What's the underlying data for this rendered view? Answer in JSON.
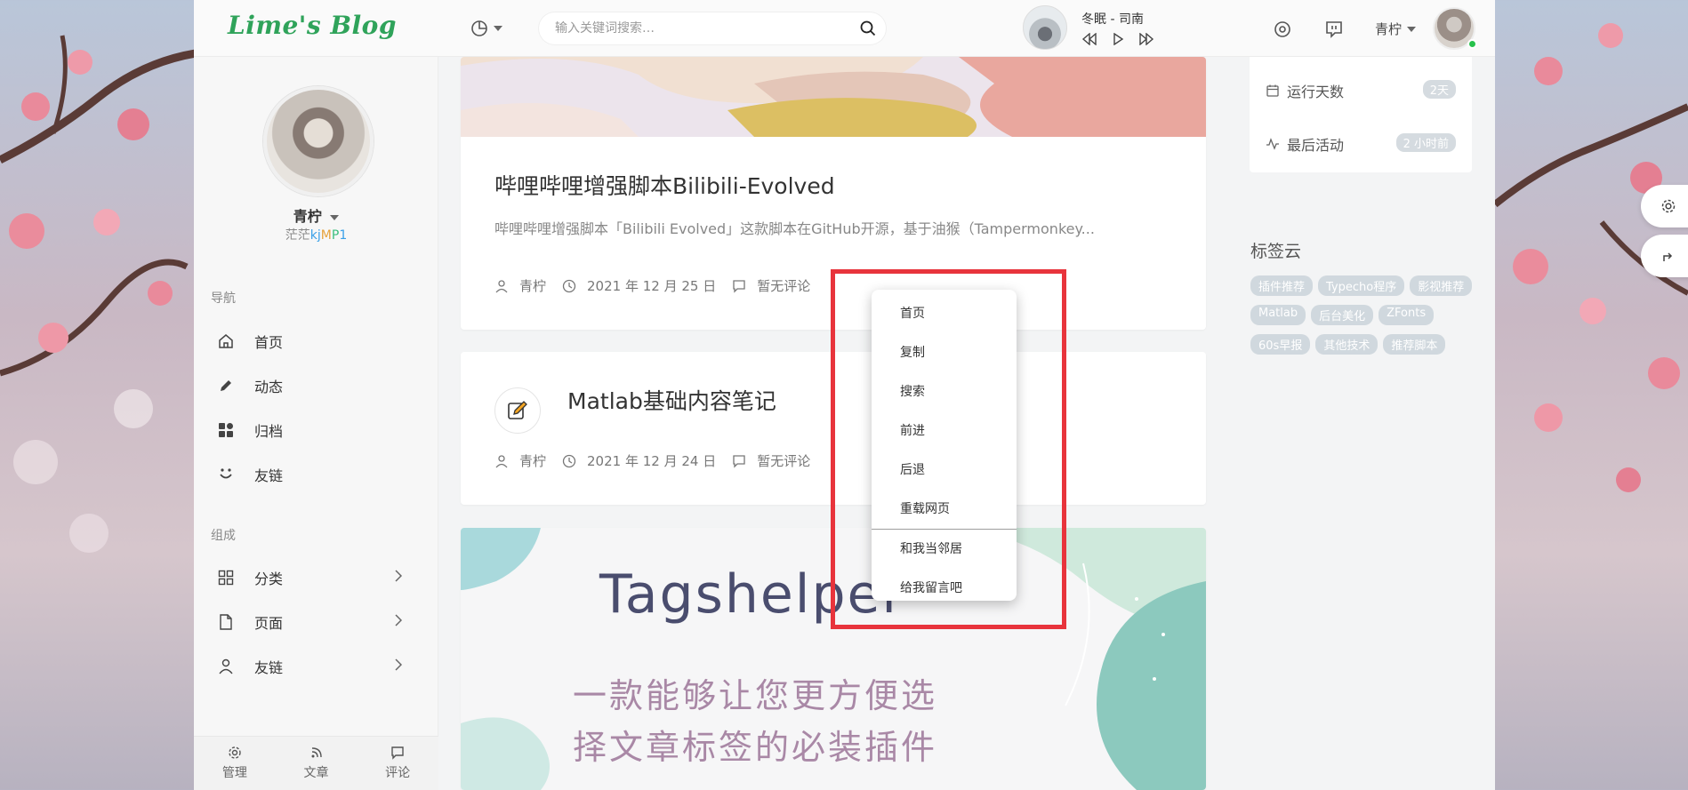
{
  "header": {
    "logo": "Lime's Blog",
    "search_placeholder": "输入关键词搜索…",
    "music": {
      "song": "冬眠 - 司南"
    },
    "user": "青柠"
  },
  "sidebar": {
    "profile": {
      "name": "青柠",
      "subtitle_prefix": "茫茫",
      "subtitle_k": "k",
      "subtitle_j": "j",
      "subtitle_m": "M",
      "subtitle_p": "P",
      "subtitle_1": "1"
    },
    "nav_label": "导航",
    "nav": [
      {
        "label": "首页",
        "icon": "home-icon"
      },
      {
        "label": "动态",
        "icon": "pencil-icon"
      },
      {
        "label": "归档",
        "icon": "archive-grid-icon"
      },
      {
        "label": "友链",
        "icon": "smile-icon"
      }
    ],
    "group_label": "组成",
    "group": [
      {
        "label": "分类",
        "icon": "category-icon"
      },
      {
        "label": "页面",
        "icon": "page-icon"
      },
      {
        "label": "友链",
        "icon": "user-icon"
      }
    ],
    "footer": [
      {
        "label": "管理",
        "icon": "gear-icon"
      },
      {
        "label": "文章",
        "icon": "rss-icon"
      },
      {
        "label": "评论",
        "icon": "comment-icon"
      }
    ]
  },
  "posts": [
    {
      "title": "哔哩哔哩增强脚本Bilibili-Evolved",
      "excerpt": "哔哩哔哩增强脚本「Bilibili Evolved」这款脚本在GitHub开源，基于油猴（Tampermonkey...",
      "author": "青柠",
      "date": "2021 年 12 月 25 日",
      "comments": "暂无评论"
    },
    {
      "title": "Matlab基础内容笔记",
      "author": "青柠",
      "date": "2021 年 12 月 24 日",
      "comments": "暂无评论"
    },
    {
      "banner_title": "Tagshelper",
      "banner_line1": "一款能够让您更方便选",
      "banner_line2": "择文章标签的必装插件"
    }
  ],
  "right": {
    "stats": [
      {
        "label": "运行天数",
        "value": "2天"
      },
      {
        "label": "最后活动",
        "value": "2 小时前"
      }
    ],
    "tagcloud_title": "标签云",
    "tags": [
      "插件推荐",
      "Typecho程序",
      "影视推荐",
      "Matlab",
      "后台美化",
      "ZFonts",
      "60s早报",
      "其他技术",
      "推荐脚本"
    ]
  },
  "context_menu": {
    "items": [
      "首页",
      "复制",
      "搜索",
      "前进",
      "后退",
      "重载网页"
    ],
    "extra": [
      "和我当邻居",
      "给我留言吧"
    ]
  },
  "colors": {
    "accent_green": "#2fa35a",
    "highlight_red": "#e8343c",
    "online": "#27c24c"
  }
}
